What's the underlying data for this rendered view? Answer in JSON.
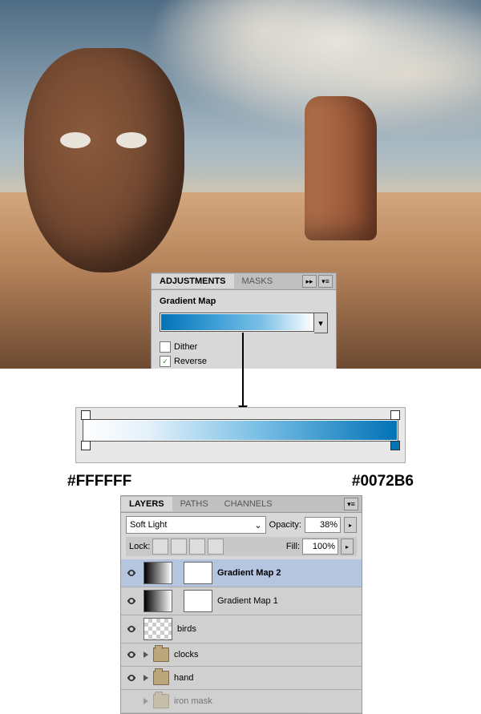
{
  "adjustments": {
    "tabs": {
      "adjustments": "ADJUSTMENTS",
      "masks": "MASKS"
    },
    "title": "Gradient Map",
    "dither": "Dither",
    "reverse": "Reverse",
    "dither_checked": false,
    "reverse_checked": true
  },
  "gradient": {
    "left_color": "#FFFFFF",
    "right_color": "#0072B6"
  },
  "layers_panel": {
    "tabs": {
      "layers": "LAYERS",
      "paths": "PATHS",
      "channels": "CHANNELS"
    },
    "blend_mode": "Soft Light",
    "opacity_label": "Opacity:",
    "opacity_value": "38%",
    "fill_label": "Fill:",
    "fill_value": "100%",
    "lock_label": "Lock:",
    "layers": [
      {
        "name": "Gradient Map 2",
        "type": "adjustment",
        "selected": true
      },
      {
        "name": "Gradient Map 1",
        "type": "adjustment",
        "selected": false
      },
      {
        "name": "birds",
        "type": "raster",
        "selected": false
      },
      {
        "name": "clocks",
        "type": "group",
        "selected": false
      },
      {
        "name": "hand",
        "type": "group",
        "selected": false
      },
      {
        "name": "iron mask",
        "type": "group",
        "selected": false,
        "hidden": true
      }
    ]
  }
}
